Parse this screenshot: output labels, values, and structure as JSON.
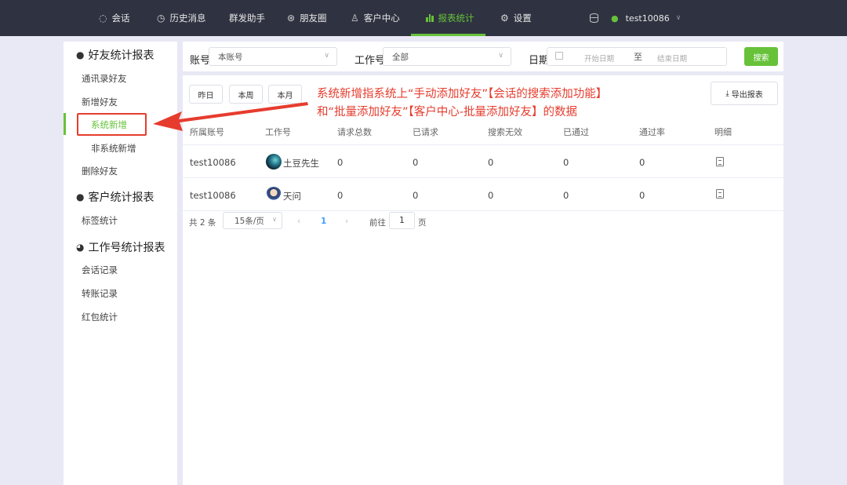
{
  "nav": {
    "items": [
      {
        "label": "会话",
        "icon": "chat-icon"
      },
      {
        "label": "历史消息",
        "icon": "clock-icon"
      },
      {
        "label": "群发助手"
      },
      {
        "label": "朋友圈",
        "icon": "aperture-icon"
      },
      {
        "label": "客户中心",
        "icon": "user-icon"
      },
      {
        "label": "报表统计",
        "icon": "bar-chart-icon",
        "active": true
      },
      {
        "label": "设置",
        "icon": "gear-icon"
      }
    ],
    "user": "test10086"
  },
  "sidebar": {
    "groups": [
      {
        "title": "好友统计报表",
        "icon": "user-icon"
      },
      {
        "title": "客户统计报表",
        "icon": "user-icon"
      },
      {
        "title": "工作号统计报表",
        "icon": "wechat-icon"
      }
    ],
    "items": [
      "通讯录好友",
      "新增好友",
      "系统新增",
      "非系统新增",
      "删除好友",
      "标签统计",
      "会话记录",
      "转账记录",
      "红包统计"
    ],
    "active": "系统新增"
  },
  "filter": {
    "account_label": "账号",
    "account_value": "本账号",
    "workno_label": "工作号",
    "workno_value": "全部",
    "date_label": "日期",
    "date_start_placeholder": "开始日期",
    "date_sep": "至",
    "date_end_placeholder": "结束日期",
    "search_label": "搜索"
  },
  "quick": {
    "yesterday": "昨日",
    "week": "本周",
    "month": "本月",
    "export": "导出报表"
  },
  "annotation": {
    "line1": "系统新增指系统上“手动添加好友”【会话的搜索添加功能】",
    "line2": "和“批量添加好友”【客户中心-批量添加好友】的数据"
  },
  "table": {
    "headers": [
      "所属账号",
      "工作号",
      "请求总数",
      "已请求",
      "搜索无效",
      "已通过",
      "通过率",
      "明细"
    ],
    "rows": [
      {
        "account": "test10086",
        "workno": "土豆先生",
        "total": "0",
        "requested": "0",
        "invalid": "0",
        "passed": "0",
        "rate": "0"
      },
      {
        "account": "test10086",
        "workno": "天问",
        "total": "0",
        "requested": "0",
        "invalid": "0",
        "passed": "0",
        "rate": "0"
      }
    ]
  },
  "pagination": {
    "total": "共 2 条",
    "page_size": "15条/页",
    "current": "1",
    "goto_label": "前往",
    "goto_value": "1",
    "page_suffix": "页"
  },
  "colors": {
    "accent": "#67c23a",
    "topbar": "#2f3341",
    "annotation": "#e63c2e"
  }
}
